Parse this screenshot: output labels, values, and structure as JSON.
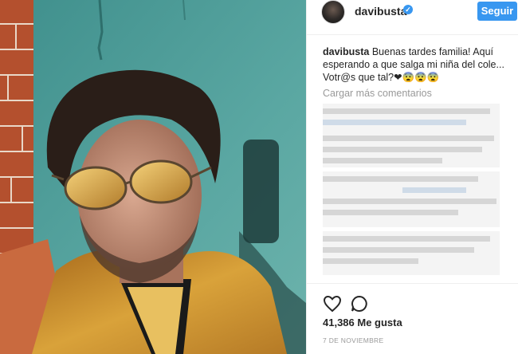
{
  "post": {
    "username": "davibusta",
    "follow_label": "Seguir",
    "caption": "Buenas tardes familia! Aquí esperando a que salga mi niña del cole... Votr@s que tal?❤😨😨😨",
    "load_more": "Cargar más comentarios",
    "likes": "41,386 Me gusta",
    "date": "7 DE NOVIEMBRE"
  },
  "icons": {
    "like": "heart-outline-icon",
    "comment": "comment-bubble-icon",
    "verified": "verified-badge-icon"
  },
  "colors": {
    "accent": "#3897f0",
    "wall": "#4f9c98",
    "jacket": "#c8932e",
    "brick": "#b4502e"
  }
}
